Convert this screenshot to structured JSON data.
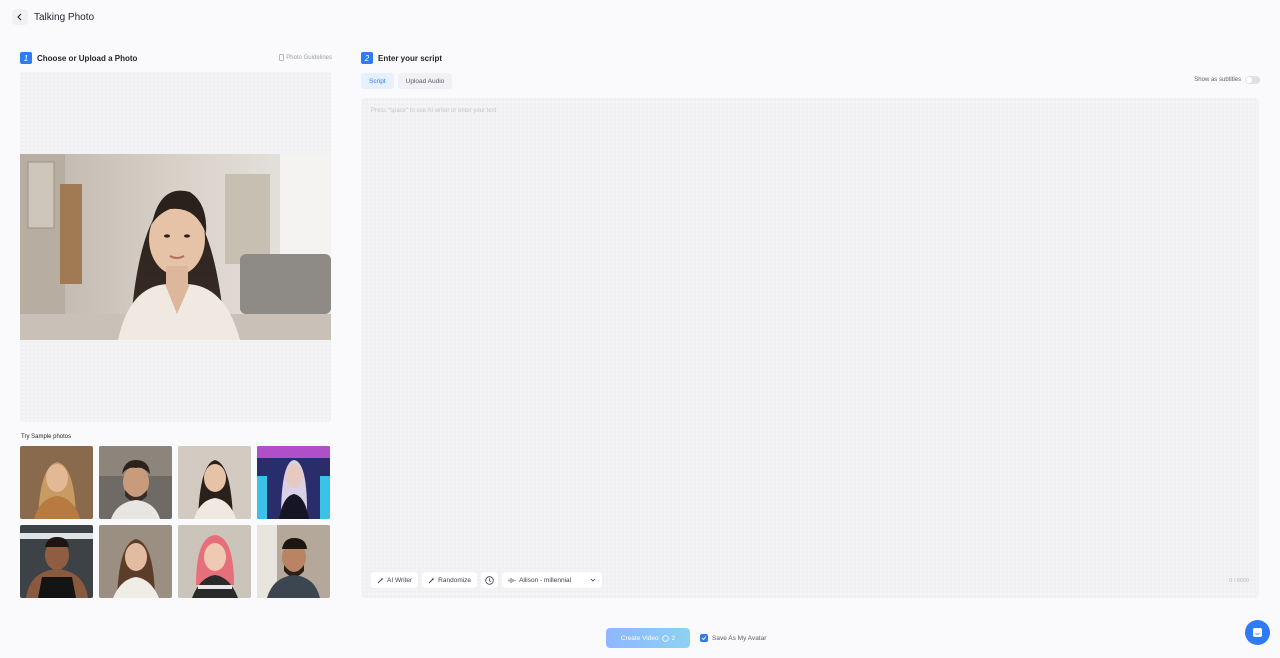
{
  "header": {
    "title": "Talking Photo",
    "back_icon": "chevron-left-icon"
  },
  "step1": {
    "number": "1",
    "title": "Choose or Upload a Photo",
    "guidelines_label": "Photo Guidelines",
    "guidelines_icon": "phone-icon"
  },
  "samples": {
    "label": "Try Sample photos",
    "items": [
      "sample-woman-blonde",
      "sample-man-beard",
      "sample-woman-asian",
      "sample-woman-neon",
      "sample-man-gym",
      "sample-woman-brunette",
      "sample-woman-pink-hair",
      "sample-man-smiling"
    ]
  },
  "step2": {
    "number": "2",
    "title": "Enter your script"
  },
  "tabs": [
    {
      "label": "Script",
      "active": true
    },
    {
      "label": "Upload Audio",
      "active": false
    }
  ],
  "subtitles": {
    "label": "Show as subtitles",
    "enabled": false
  },
  "editor": {
    "placeholder": "Press “space” to use AI writer or enter your text",
    "counter": "0 / 8000"
  },
  "toolbar": {
    "ai_writer_label": "AI Writer",
    "randomize_label": "Randomize",
    "voice_label": "Allison - millennial"
  },
  "footer": {
    "create_label": "Create Video",
    "credits": "2",
    "save_avatar_label": "Save As My Avatar",
    "save_avatar_checked": true
  },
  "colors": {
    "accent": "#2f7bf5",
    "create_gradient_start": "#8fb6ff",
    "create_gradient_end": "#8dd2f2"
  }
}
